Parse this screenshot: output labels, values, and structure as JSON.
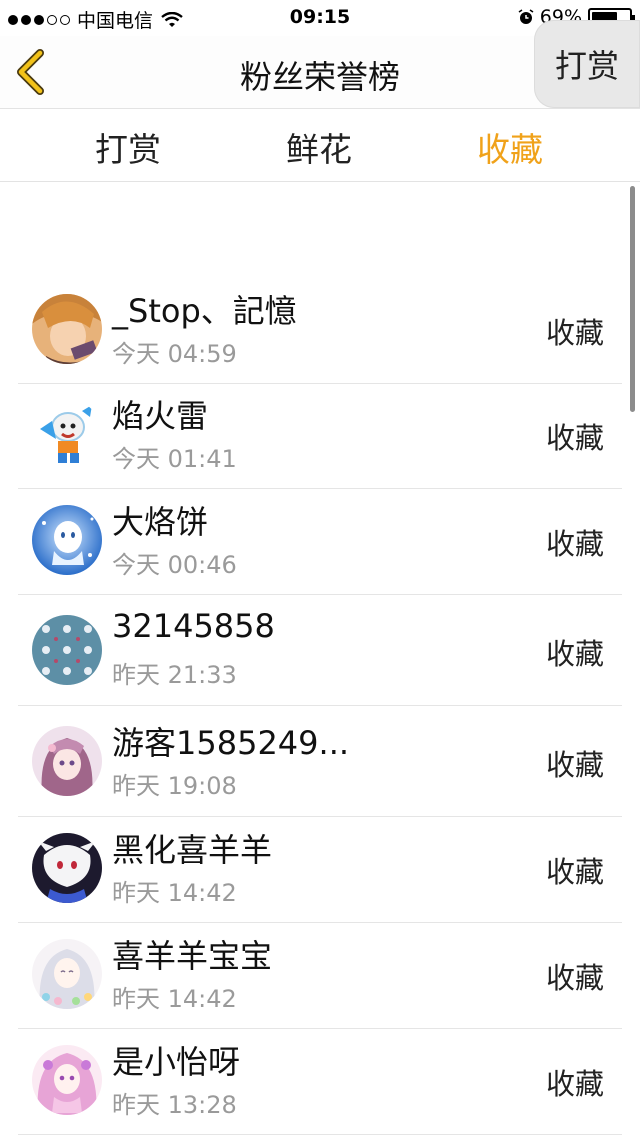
{
  "status_bar": {
    "carrier": "中国电信",
    "time": "09:15",
    "battery_text": "69%",
    "battery_level": 0.69
  },
  "header": {
    "title": "粉丝荣誉榜",
    "tip_button_label": "打赏",
    "back_icon": "chevron-left-icon",
    "accent_color": "#f0a21a"
  },
  "tabs": [
    {
      "label": "打赏",
      "active": false
    },
    {
      "label": "鲜花",
      "active": false
    },
    {
      "label": "收藏",
      "active": true
    }
  ],
  "fans": [
    {
      "name": "_Stop、記憶",
      "time": "今天 04:59",
      "action": "收藏",
      "avatar": "anime-boy-avatar"
    },
    {
      "name": "焰火雷",
      "time": "今天 01:41",
      "action": "收藏",
      "avatar": "cartoon-goat-avatar"
    },
    {
      "name": "大烙饼",
      "time": "今天 00:46",
      "action": "收藏",
      "avatar": "blue-ghost-avatar"
    },
    {
      "name": "32145858",
      "time": "昨天 21:33",
      "action": "收藏",
      "avatar": "pattern-avatar"
    },
    {
      "name": "游客1585249...",
      "time": "昨天 19:08",
      "action": "收藏",
      "avatar": "anime-girl-avatar"
    },
    {
      "name": "黑化喜羊羊",
      "time": "昨天 14:42",
      "action": "收藏",
      "avatar": "dark-goat-avatar"
    },
    {
      "name": "喜羊羊宝宝",
      "time": "昨天 14:42",
      "action": "收藏",
      "avatar": "fairy-girl-avatar"
    },
    {
      "name": "是小怡呀",
      "time": "昨天 13:28",
      "action": "收藏",
      "avatar": "pink-girl-avatar"
    }
  ]
}
